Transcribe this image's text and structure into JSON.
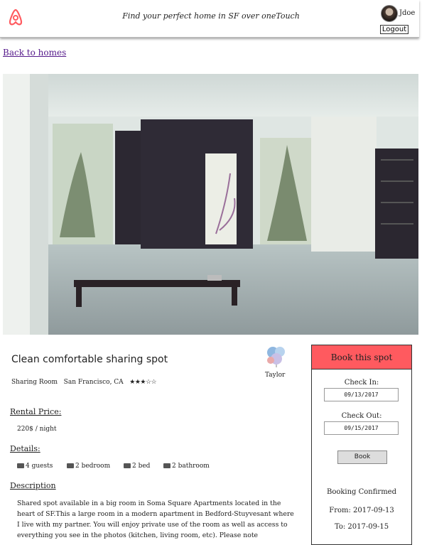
{
  "header": {
    "tagline": "Find your perfect home in SF over oneTouch",
    "username": "Jdoe",
    "logout_label": "Logout"
  },
  "nav": {
    "back_label": "Back to homes"
  },
  "listing": {
    "title": "Clean comfortable sharing spot",
    "room_type": "Sharing Room",
    "location": "San Francisco, CA",
    "stars_display": "★★★☆☆",
    "rating": 3,
    "host_name": "Taylor",
    "rental_price_heading": "Rental Price:",
    "price": "220$ / night",
    "details_heading": "Details:",
    "amenities": [
      {
        "icon": "guests-icon",
        "label": "4 guests"
      },
      {
        "icon": "bedroom-icon",
        "label": "2 bedroom"
      },
      {
        "icon": "bed-icon",
        "label": "2 bed"
      },
      {
        "icon": "bathroom-icon",
        "label": "2 bathroom"
      }
    ],
    "description_heading": "Description",
    "description": "Shared spot available in a big room in Soma Square Apartments located in the heart of SF.This a large room in a modern apartment in Bedford-Stuyvesant where I live with my partner. You will enjoy private use of the room as well as access to everything you see in the photos (kitchen, living room, etc). Please note"
  },
  "booking": {
    "heading": "Book this spot",
    "checkin_label": "Check In:",
    "checkin_value": "09/13/2017",
    "checkout_label": "Check Out:",
    "checkout_value": "09/15/2017",
    "book_label": "Book",
    "confirmed_label": "Booking Confirmed",
    "from_text": "From: 2017-09-13",
    "to_text": "To: 2017-09-15"
  },
  "colors": {
    "brand": "#ff5a5f",
    "link": "#551a8b"
  }
}
